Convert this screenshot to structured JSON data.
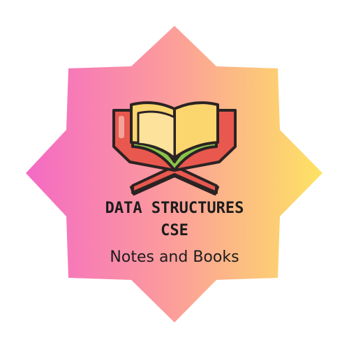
{
  "logo": {
    "title_line_1": "DATA STRUCTURES",
    "title_line_2": "CSE",
    "subtitle": "Notes and Books",
    "icon": "open-book-on-stand-icon",
    "colors": {
      "gradient_left": "#f46fc0",
      "gradient_mid": "#fb9aa0",
      "gradient_right": "#fde06a",
      "book_red": "#e8584e",
      "book_red_light": "#f07a6e",
      "page_yellow": "#fbd56e",
      "page_green": "#8bc34a",
      "outline": "#2b2323",
      "text": "#1c1c1c"
    }
  }
}
